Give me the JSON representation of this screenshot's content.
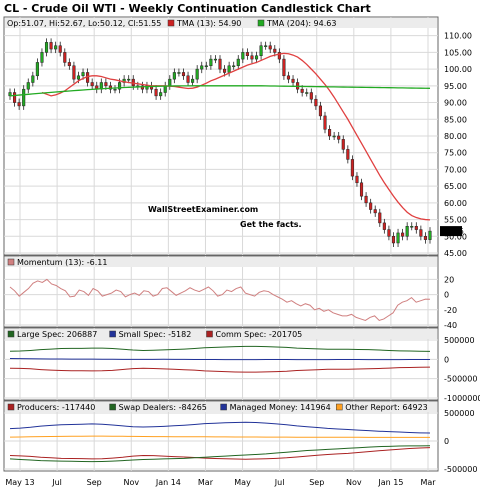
{
  "chart_data": [
    {
      "type": "candlestick",
      "title": "CL - Crude Oil WTI - Weekly Continuation Candlestick Chart",
      "ohlc_label": "Op:51.07, Hi:52.67, Lo:50.12, Cl:51.55",
      "legend": [
        {
          "label": "TMA (13): 54.90",
          "color": "#cc2222"
        },
        {
          "label": "TMA (204): 94.63",
          "color": "#22aa22"
        }
      ],
      "ylim": [
        45,
        112
      ],
      "y_ticks": [
        "110.00",
        "105.00",
        "100.00",
        "95.00",
        "90.00",
        "85.00",
        "80.00",
        "75.00",
        "70.00",
        "65.00",
        "60.00",
        "55.00",
        "50.00",
        "45.00"
      ],
      "last_value_label": "51.55",
      "watermark": {
        "line1": "WallStreetExaminer.com",
        "line2": "Get the facts."
      },
      "x_labels": [
        "May 13",
        "Jul",
        "Sep",
        "Nov",
        "Jan 14",
        "Mar",
        "May",
        "Jul",
        "Sep",
        "Nov",
        "Jan 15",
        "Mar"
      ],
      "close_values": [
        93,
        90,
        89,
        94,
        96,
        98,
        102,
        105,
        108,
        106,
        107,
        105,
        102,
        101,
        97,
        98,
        99,
        96,
        95,
        94,
        96,
        95,
        94,
        94,
        96,
        97,
        97,
        95,
        95,
        94,
        95,
        94,
        92,
        93,
        95,
        97,
        99,
        99,
        98,
        96,
        97,
        100,
        101,
        101,
        103,
        103,
        100,
        99,
        101,
        101,
        103,
        105,
        104,
        103,
        104,
        107,
        107,
        106,
        105,
        103,
        98,
        97,
        96,
        94,
        93,
        93,
        91,
        89,
        86,
        82,
        80,
        80,
        79,
        76,
        73,
        68,
        66,
        62,
        60,
        58,
        57,
        54,
        52,
        50,
        48,
        51,
        50,
        53,
        53,
        52,
        50,
        49,
        51.55
      ],
      "tma13": [
        93,
        92.5,
        92,
        92.3,
        92.8,
        93.5,
        94.5,
        95.5,
        96.5,
        97.2,
        97.8,
        98,
        98,
        97.8,
        97.4,
        97,
        96.8,
        96.5,
        96.2,
        96,
        95.8,
        95.6,
        95.4,
        95.2,
        95,
        95,
        95,
        95,
        94.9,
        94.8,
        94.6,
        94.4,
        94.2,
        94.3,
        94.6,
        95.2,
        95.8,
        96.5,
        97,
        97.6,
        98.2,
        98.8,
        99.4,
        100,
        100.6,
        101.2,
        101.6,
        102,
        102.6,
        103.2,
        103.8,
        104.2,
        104.5,
        104.7,
        104.6,
        104.2,
        103.6,
        102.6,
        101.4,
        100,
        98.6,
        97,
        95.4,
        93.6,
        91.6,
        89.4,
        87.2,
        85,
        82.6,
        80.2,
        77.8,
        75.4,
        73,
        70.6,
        68.2,
        66,
        64,
        62,
        60.2,
        58.6,
        57.2,
        56.2,
        55.6,
        55.2,
        55,
        54.9
      ]
    },
    {
      "type": "line",
      "title": "Momentum (13): -6.11",
      "color": "#d08080",
      "ylim": [
        -40,
        35
      ],
      "y_ticks": [
        "20",
        "0",
        "-20",
        "-40"
      ],
      "values": [
        10,
        5,
        -2,
        3,
        8,
        15,
        18,
        16,
        20,
        14,
        12,
        8,
        5,
        -3,
        -2,
        6,
        4,
        -1,
        8,
        5,
        -2,
        0,
        2,
        6,
        4,
        -3,
        0,
        2,
        -1,
        5,
        4,
        -2,
        0,
        8,
        9,
        4,
        -1,
        2,
        5,
        9,
        6,
        4,
        7,
        10,
        5,
        -2,
        0,
        6,
        4,
        8,
        10,
        2,
        0,
        -2,
        3,
        5,
        4,
        0,
        -3,
        -6,
        -10,
        -8,
        -12,
        -15,
        -12,
        -14,
        -20,
        -18,
        -22,
        -20,
        -24,
        -26,
        -28,
        -28,
        -26,
        -30,
        -32,
        -34,
        -30,
        -28,
        -34,
        -32,
        -28,
        -24,
        -14,
        -10,
        -8,
        -4,
        -10,
        -8,
        -6,
        -6.11
      ]
    },
    {
      "type": "line",
      "series": [
        {
          "name": "Large Spec: 206887",
          "color": "#226622",
          "values": [
            210000,
            215000,
            230000,
            250000,
            265000,
            280000,
            285000,
            285000,
            290000,
            290000,
            280000,
            260000,
            240000,
            230000,
            235000,
            245000,
            255000,
            265000,
            280000,
            300000,
            310000,
            320000,
            330000,
            335000,
            335000,
            330000,
            320000,
            310000,
            290000,
            280000,
            270000,
            260000,
            260000,
            260000,
            255000,
            250000,
            240000,
            230000,
            220000,
            215000,
            210000,
            206887
          ]
        },
        {
          "name": "Small Spec: -5182",
          "color": "#223399",
          "values": [
            20000,
            18000,
            15000,
            12000,
            10000,
            8000,
            6000,
            6000,
            4000,
            3000,
            2000,
            0,
            -2000,
            -1000,
            0,
            1000,
            -1000,
            -2000,
            -3000,
            -4000,
            -5000,
            -6000,
            -7000,
            -8000,
            -6000,
            -5000,
            -4000,
            -5000,
            -6000,
            -7000,
            -8000,
            -6000,
            -5000,
            -4000,
            -5000,
            -6000,
            -7000,
            -8000,
            -6000,
            -5000,
            -5500,
            -5182
          ]
        },
        {
          "name": "Comm Spec: -201705",
          "color": "#aa2222",
          "values": [
            -230000,
            -235000,
            -245000,
            -265000,
            -280000,
            -290000,
            -295000,
            -295000,
            -298000,
            -296000,
            -285000,
            -262000,
            -240000,
            -232000,
            -238000,
            -248000,
            -258000,
            -268000,
            -280000,
            -298000,
            -308000,
            -318000,
            -326000,
            -330000,
            -330000,
            -325000,
            -318000,
            -308000,
            -290000,
            -280000,
            -268000,
            -258000,
            -256000,
            -255000,
            -250000,
            -245000,
            -236000,
            -226000,
            -216000,
            -210000,
            -206000,
            -201705
          ]
        }
      ],
      "y_ticks": [
        "500000",
        "0",
        "-500000",
        "-1000000"
      ],
      "ylim": [
        -1000000,
        500000
      ]
    },
    {
      "type": "line",
      "series": [
        {
          "name": "Producers: -117440",
          "color": "#aa2222",
          "values": [
            -260000,
            -265000,
            -275000,
            -290000,
            -300000,
            -310000,
            -312000,
            -315000,
            -320000,
            -318000,
            -305000,
            -290000,
            -270000,
            -260000,
            -262000,
            -270000,
            -278000,
            -285000,
            -295000,
            -305000,
            -312000,
            -318000,
            -322000,
            -325000,
            -322000,
            -318000,
            -310000,
            -300000,
            -285000,
            -270000,
            -255000,
            -240000,
            -230000,
            -220000,
            -205000,
            -190000,
            -175000,
            -160000,
            -148000,
            -135000,
            -125000,
            -117440
          ]
        },
        {
          "name": "Swap Dealers: -84265",
          "color": "#226622",
          "values": [
            -320000,
            -330000,
            -340000,
            -350000,
            -355000,
            -360000,
            -362000,
            -365000,
            -368000,
            -366000,
            -360000,
            -350000,
            -340000,
            -330000,
            -325000,
            -320000,
            -315000,
            -310000,
            -300000,
            -290000,
            -280000,
            -270000,
            -260000,
            -250000,
            -240000,
            -230000,
            -215000,
            -200000,
            -185000,
            -170000,
            -160000,
            -150000,
            -140000,
            -130000,
            -120000,
            -110000,
            -100000,
            -95000,
            -90000,
            -88000,
            -86000,
            -84265
          ]
        },
        {
          "name": "Managed Money: 141964",
          "color": "#223399",
          "values": [
            220000,
            230000,
            245000,
            265000,
            280000,
            290000,
            295000,
            300000,
            305000,
            300000,
            285000,
            270000,
            255000,
            250000,
            255000,
            262000,
            272000,
            282000,
            295000,
            310000,
            318000,
            325000,
            330000,
            334000,
            330000,
            320000,
            305000,
            290000,
            270000,
            255000,
            240000,
            225000,
            215000,
            205000,
            195000,
            185000,
            175000,
            168000,
            160000,
            152000,
            146000,
            141964
          ]
        },
        {
          "name": "Other Report: 64923",
          "color": "#ffa020",
          "values": [
            70000,
            72000,
            75000,
            78000,
            80000,
            82000,
            84000,
            85000,
            86000,
            86000,
            85000,
            84000,
            82000,
            80000,
            79000,
            78000,
            77000,
            76000,
            76000,
            75000,
            74000,
            73000,
            72000,
            72000,
            71000,
            70000,
            70000,
            69000,
            68000,
            68000,
            67000,
            67000,
            66000,
            66000,
            66000,
            65500,
            65500,
            65000,
            65000,
            65000,
            65000,
            64923
          ]
        }
      ],
      "y_ticks": [
        "500000",
        "0",
        "-500000"
      ],
      "ylim": [
        -500000,
        500000
      ]
    }
  ]
}
